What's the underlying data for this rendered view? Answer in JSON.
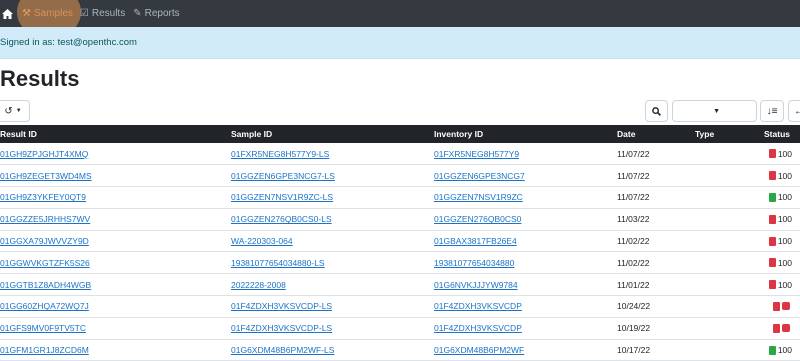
{
  "nav": {
    "items": [
      {
        "label": "Samples"
      },
      {
        "label": "Results"
      },
      {
        "label": "Reports"
      }
    ]
  },
  "signin": {
    "text": "Signed in as: test@openthc.com"
  },
  "page": {
    "title": "Results"
  },
  "toolbar": {
    "select_value": ""
  },
  "table": {
    "headers": [
      "Result ID",
      "Sample ID",
      "Inventory ID",
      "Date",
      "Type",
      "Status"
    ],
    "rows": [
      {
        "result_id": "01GH9ZPJGHJT4XMQ",
        "sample_id": "01FXR5NEG8H577Y9-LS",
        "inventory_id": "01FXR5NEG8H577Y9",
        "date": "11/07/22",
        "type": "",
        "status": "100",
        "icons": [
          "pdf"
        ]
      },
      {
        "result_id": "01GH9ZEGET3WD4MS",
        "sample_id": "01GGZEN6GPE3NCG7-LS",
        "inventory_id": "01GGZEN6GPE3NCG7",
        "date": "11/07/22",
        "type": "",
        "status": "100",
        "icons": [
          "pdf"
        ]
      },
      {
        "result_id": "01GH9Z3YKFEY0QT9",
        "sample_id": "01GGZEN7NSV1R9ZC-LS",
        "inventory_id": "01GGZEN7NSV1R9ZC",
        "date": "11/07/22",
        "type": "",
        "status": "100",
        "icons": [
          "xls"
        ]
      },
      {
        "result_id": "01GGZZE5JRHHS7WV",
        "sample_id": "01GGZEN276QB0CS0-LS",
        "inventory_id": "01GGZEN276QB0CS0",
        "date": "11/03/22",
        "type": "",
        "status": "100",
        "icons": [
          "pdf"
        ]
      },
      {
        "result_id": "01GGXA79JWVVZY9D",
        "sample_id": "WA-220303-064",
        "inventory_id": "01GBAX3817FB26E4",
        "date": "11/02/22",
        "type": "",
        "status": "100",
        "icons": [
          "pdf"
        ]
      },
      {
        "result_id": "01GGWVKGTZFK5S26",
        "sample_id": "19381077654034880-LS",
        "inventory_id": "19381077654034880",
        "date": "11/02/22",
        "type": "",
        "status": "100",
        "icons": [
          "pdf"
        ]
      },
      {
        "result_id": "01GGTB1Z8ADH4WGB",
        "sample_id": "2022228-2008",
        "inventory_id": "01G6NVKJJJYW9784",
        "date": "11/01/22",
        "type": "",
        "status": "100",
        "icons": [
          "pdf"
        ]
      },
      {
        "result_id": "01GG60ZHQA72WQ7J",
        "sample_id": "01F4ZDXH3VKSVCDP-LS",
        "inventory_id": "01F4ZDXH3VKSVCDP",
        "date": "10/24/22",
        "type": "",
        "status": "",
        "icons": [
          "pdf",
          "chk"
        ]
      },
      {
        "result_id": "01GFS9MV0F9TV5TC",
        "sample_id": "01F4ZDXH3VKSVCDP-LS",
        "inventory_id": "01F4ZDXH3VKSVCDP",
        "date": "10/19/22",
        "type": "",
        "status": "",
        "icons": [
          "pdf",
          "chk"
        ]
      },
      {
        "result_id": "01GFM1GR1J8ZCD6M",
        "sample_id": "01G6XDM48B6PM2WF-LS",
        "inventory_id": "01G6XDM48B6PM2WF",
        "date": "10/17/22",
        "type": "",
        "status": "100",
        "icons": [
          "xls"
        ]
      }
    ]
  }
}
